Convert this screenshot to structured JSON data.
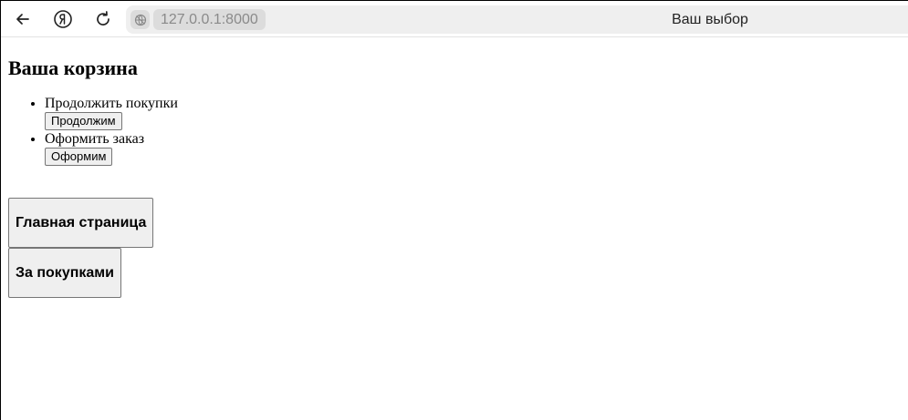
{
  "browser": {
    "url": "127.0.0.1:8000",
    "tab_title": "Ваш выбор",
    "icons": [
      "back-arrow-icon",
      "yandex-logo-icon",
      "reload-icon",
      "site-info-icon"
    ]
  },
  "page": {
    "title": "Ваша корзина",
    "options": [
      {
        "label": "Продолжить покупки",
        "button": "Продолжим"
      },
      {
        "label": "Оформить заказ",
        "button": "Оформим"
      }
    ],
    "main_page_button": "Главная страница",
    "shopping_button": "За покупками"
  }
}
